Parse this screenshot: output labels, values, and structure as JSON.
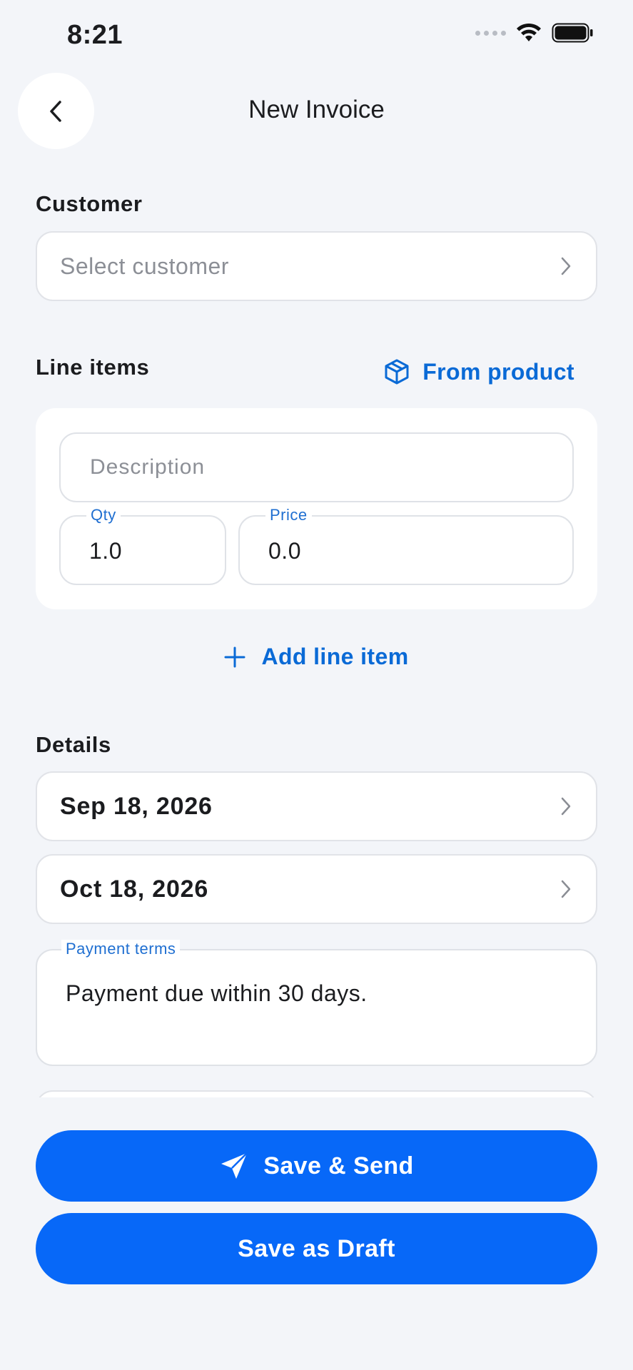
{
  "status_bar": {
    "time": "8:21"
  },
  "header": {
    "title": "New Invoice"
  },
  "customer": {
    "label": "Customer",
    "placeholder": "Select customer"
  },
  "line_items": {
    "label": "Line items",
    "from_product_label": "From product",
    "description_placeholder": "Description",
    "qty_label": "Qty",
    "qty_value": "1.0",
    "price_label": "Price",
    "price_value": "0.0",
    "add_label": "Add line item"
  },
  "details": {
    "label": "Details",
    "issue_date": "Sep 18, 2026",
    "due_date": "Oct 18, 2026",
    "payment_terms_label": "Payment terms",
    "payment_terms_value": "Payment due within 30 days."
  },
  "actions": {
    "save_send_label": "Save & Send",
    "save_draft_label": "Save as Draft"
  },
  "colors": {
    "accent": "#0768f8",
    "link": "#0a6ad6",
    "background": "#f3f5f9"
  }
}
